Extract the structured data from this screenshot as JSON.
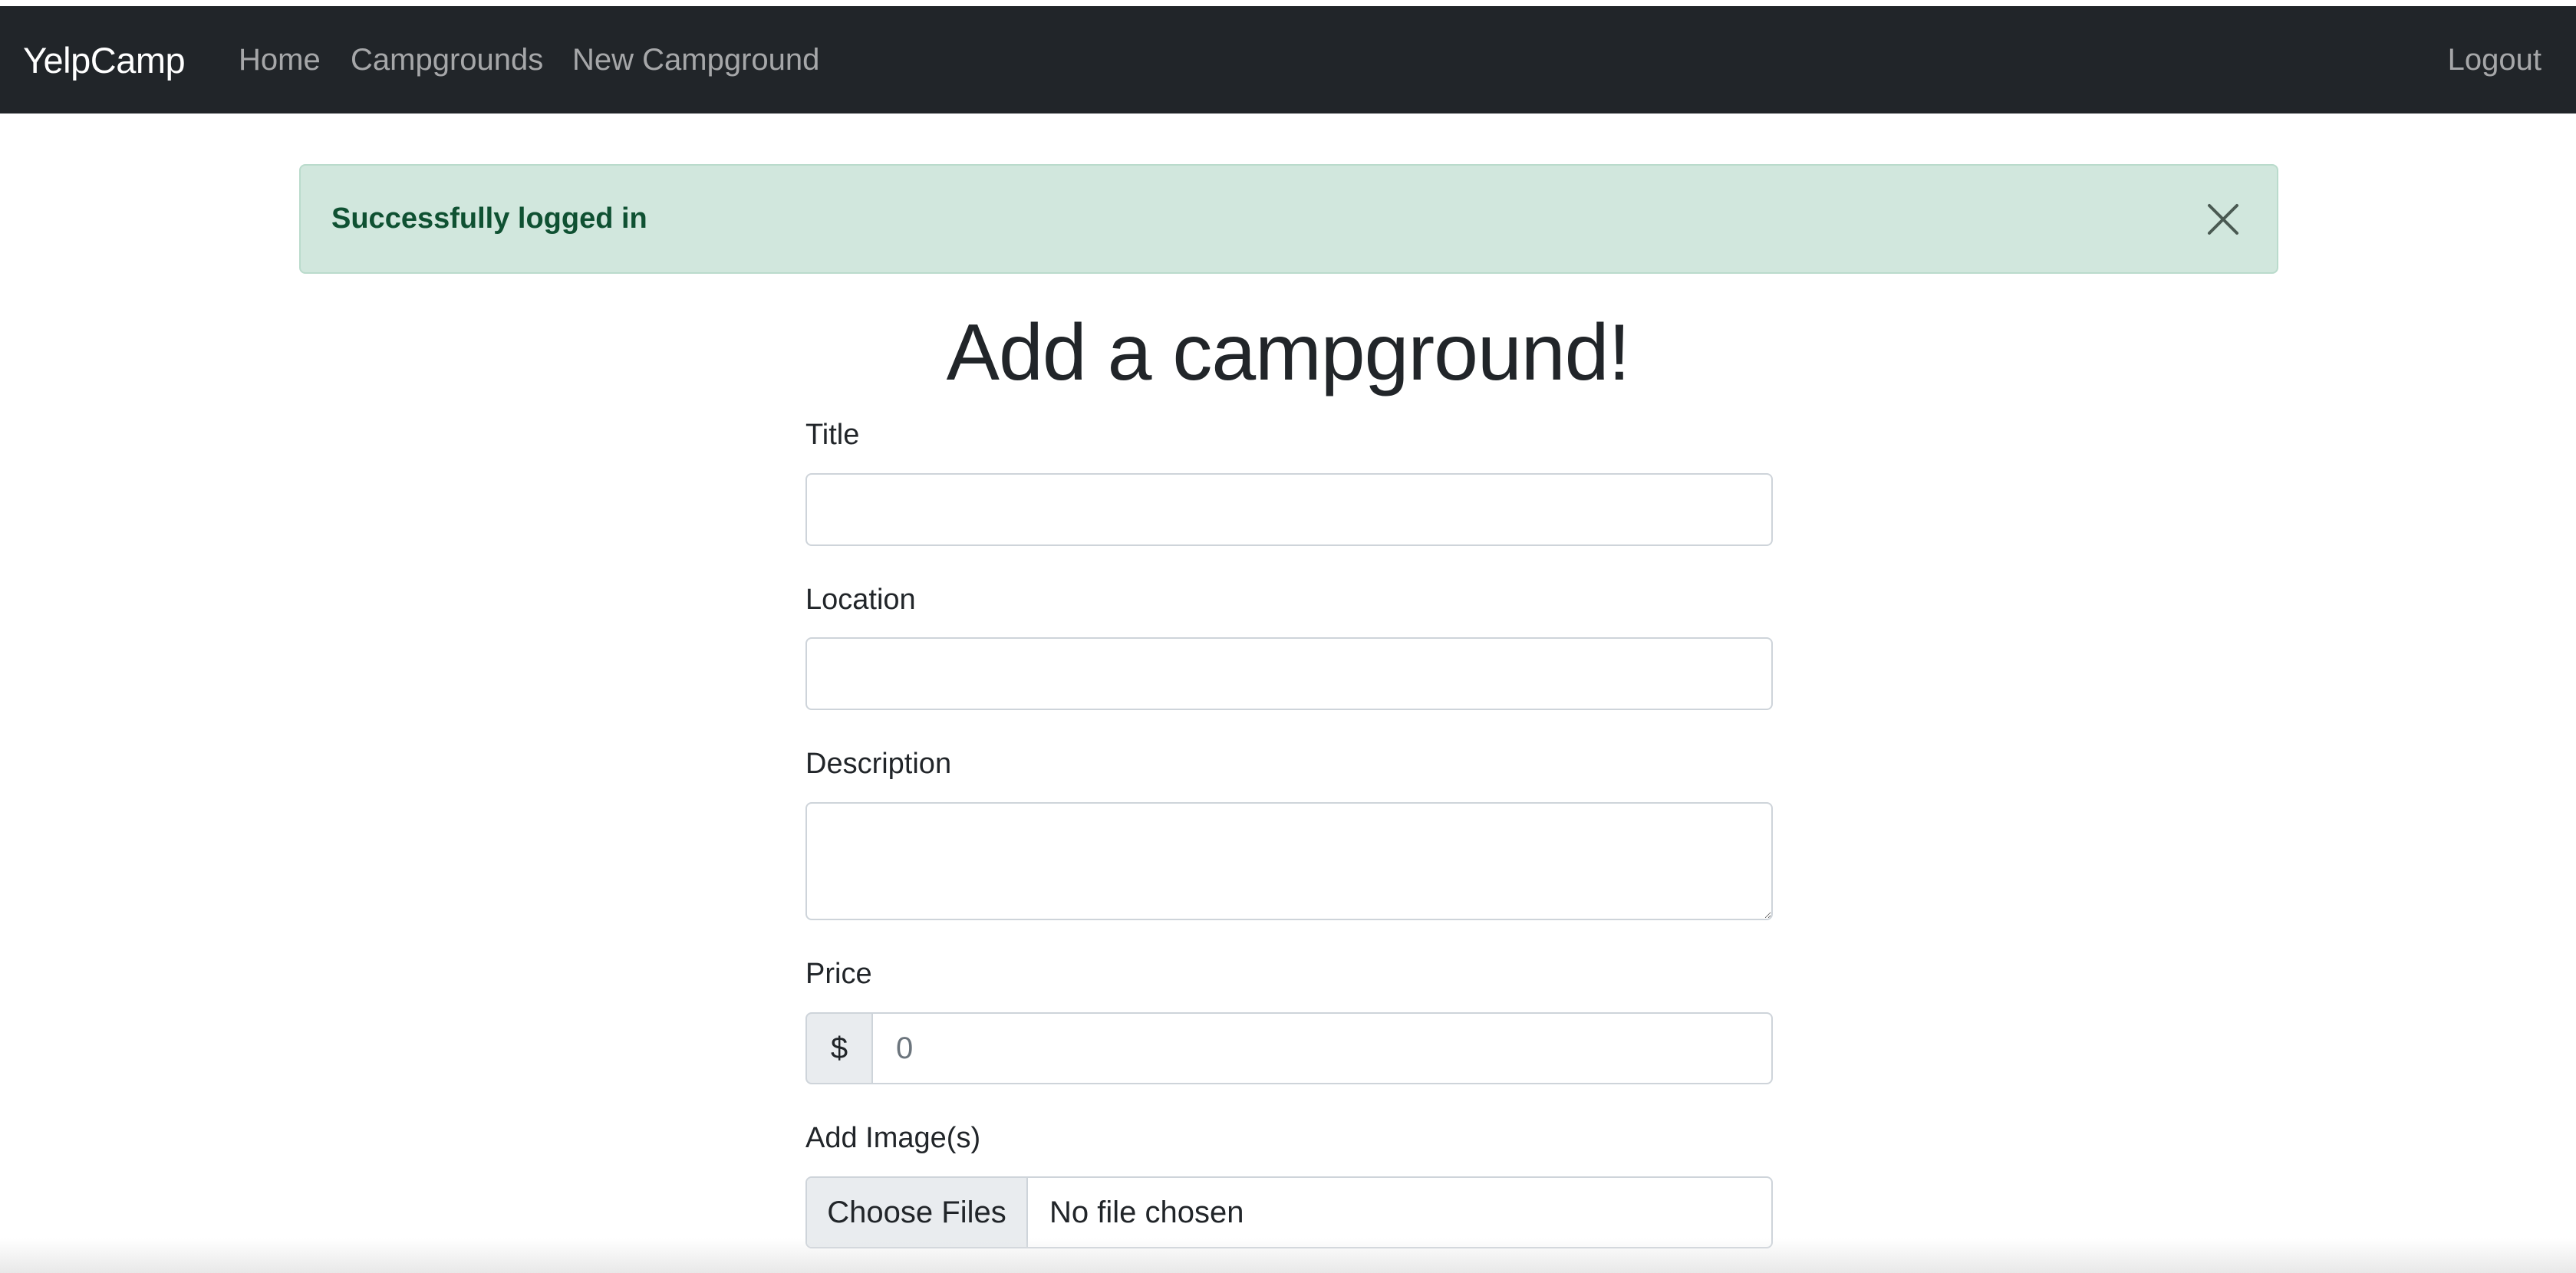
{
  "navbar": {
    "brand": "YelpCamp",
    "links": [
      {
        "label": "Home"
      },
      {
        "label": "Campgrounds"
      },
      {
        "label": "New Campground"
      }
    ],
    "logout": "Logout",
    "background": "#212529"
  },
  "alert": {
    "message": "Successfully logged in",
    "close_icon": "close-icon",
    "background": "#d1e7dd",
    "text_color": "#0f5132"
  },
  "page": {
    "heading": "Add a campground!"
  },
  "form": {
    "title": {
      "label": "Title",
      "value": ""
    },
    "location": {
      "label": "Location",
      "value": ""
    },
    "description": {
      "label": "Description",
      "value": ""
    },
    "price": {
      "label": "Price",
      "prefix": "$",
      "placeholder": "0",
      "value": ""
    },
    "images": {
      "label": "Add Image(s)",
      "button": "Choose Files",
      "status": "No file chosen"
    }
  }
}
